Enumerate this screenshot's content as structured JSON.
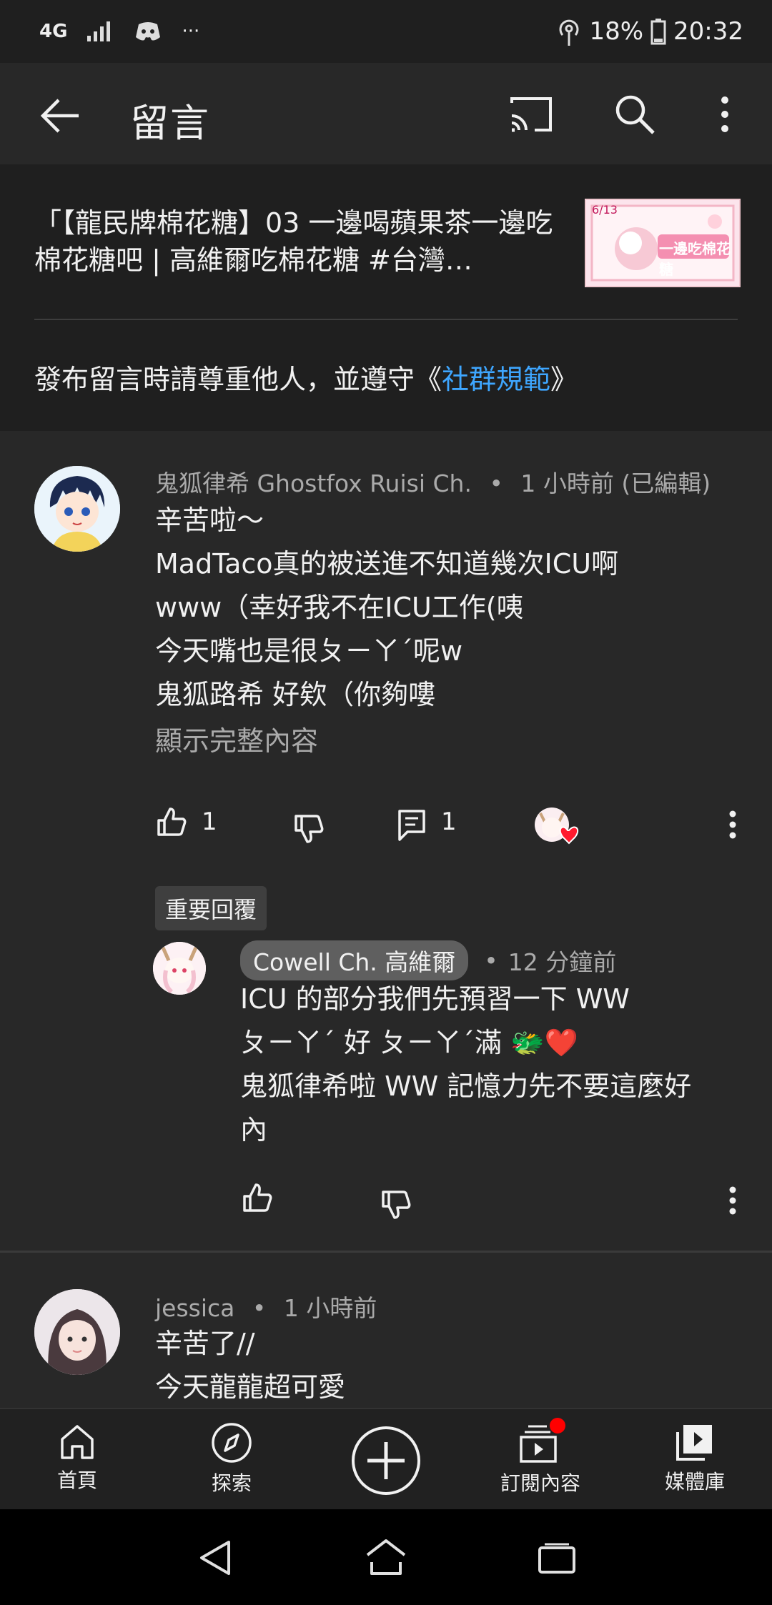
{
  "status_bar": {
    "network": "4G",
    "more": "···",
    "battery_percent": "18%",
    "time": "20:32"
  },
  "app_bar": {
    "title": "留言",
    "icons": [
      "back-arrow-icon",
      "cast-icon",
      "search-icon",
      "more-vert-icon"
    ]
  },
  "video": {
    "title": "「【龍民牌棉花糖】03 一邊喝蘋果茶一邊吃棉花糖吧 | 高維爾吃棉花糖 #台灣…",
    "thumb_text": "一邊吃棉花糖",
    "thumb_date": "6/13"
  },
  "guidelines": {
    "prefix": "發布留言時請尊重他人，並遵守《",
    "link": "社群規範",
    "suffix": "》"
  },
  "comments": [
    {
      "author": "鬼狐律希 Ghostfox Ruisi Ch.",
      "time": "1 小時前 (已編輯)",
      "lines": [
        "辛苦啦～",
        "MadTaco真的被送進不知道幾次ICU啊",
        "www（幸好我不在ICU工作(咦",
        "今天嘴也是很ㄆㄧㄚˊ呢w",
        "鬼狐路希 好欸（你夠嘍"
      ],
      "show_more": "顯示完整內容",
      "likes": "1",
      "replies": "1",
      "pinned_label": "重要回覆",
      "reply": {
        "author": "Cowell Ch. 高維爾",
        "time": "12 分鐘前",
        "lines": [
          "ICU 的部分我們先預習一下 WW",
          "ㄆㄧㄚˊ 好 ㄆㄧㄚˊ滿 🐲❤️",
          "鬼狐律希啦 WW 記憶力先不要這麼好",
          "內"
        ]
      }
    },
    {
      "author": "jessica",
      "time": "1 小時前",
      "lines": [
        "辛苦了//",
        "今天龍龍超可愛"
      ]
    }
  ],
  "bottom_nav": [
    {
      "label": "首頁",
      "icon": "home-icon"
    },
    {
      "label": "探索",
      "icon": "explore-icon"
    },
    {
      "label": "",
      "icon": "add-icon"
    },
    {
      "label": "訂閱內容",
      "icon": "subscriptions-icon"
    },
    {
      "label": "媒體庫",
      "icon": "library-icon"
    }
  ],
  "colors": {
    "background": "#282828",
    "link": "#3ea6ff",
    "secondary_text": "#aaaaaa",
    "notification_dot": "#ff0000"
  }
}
